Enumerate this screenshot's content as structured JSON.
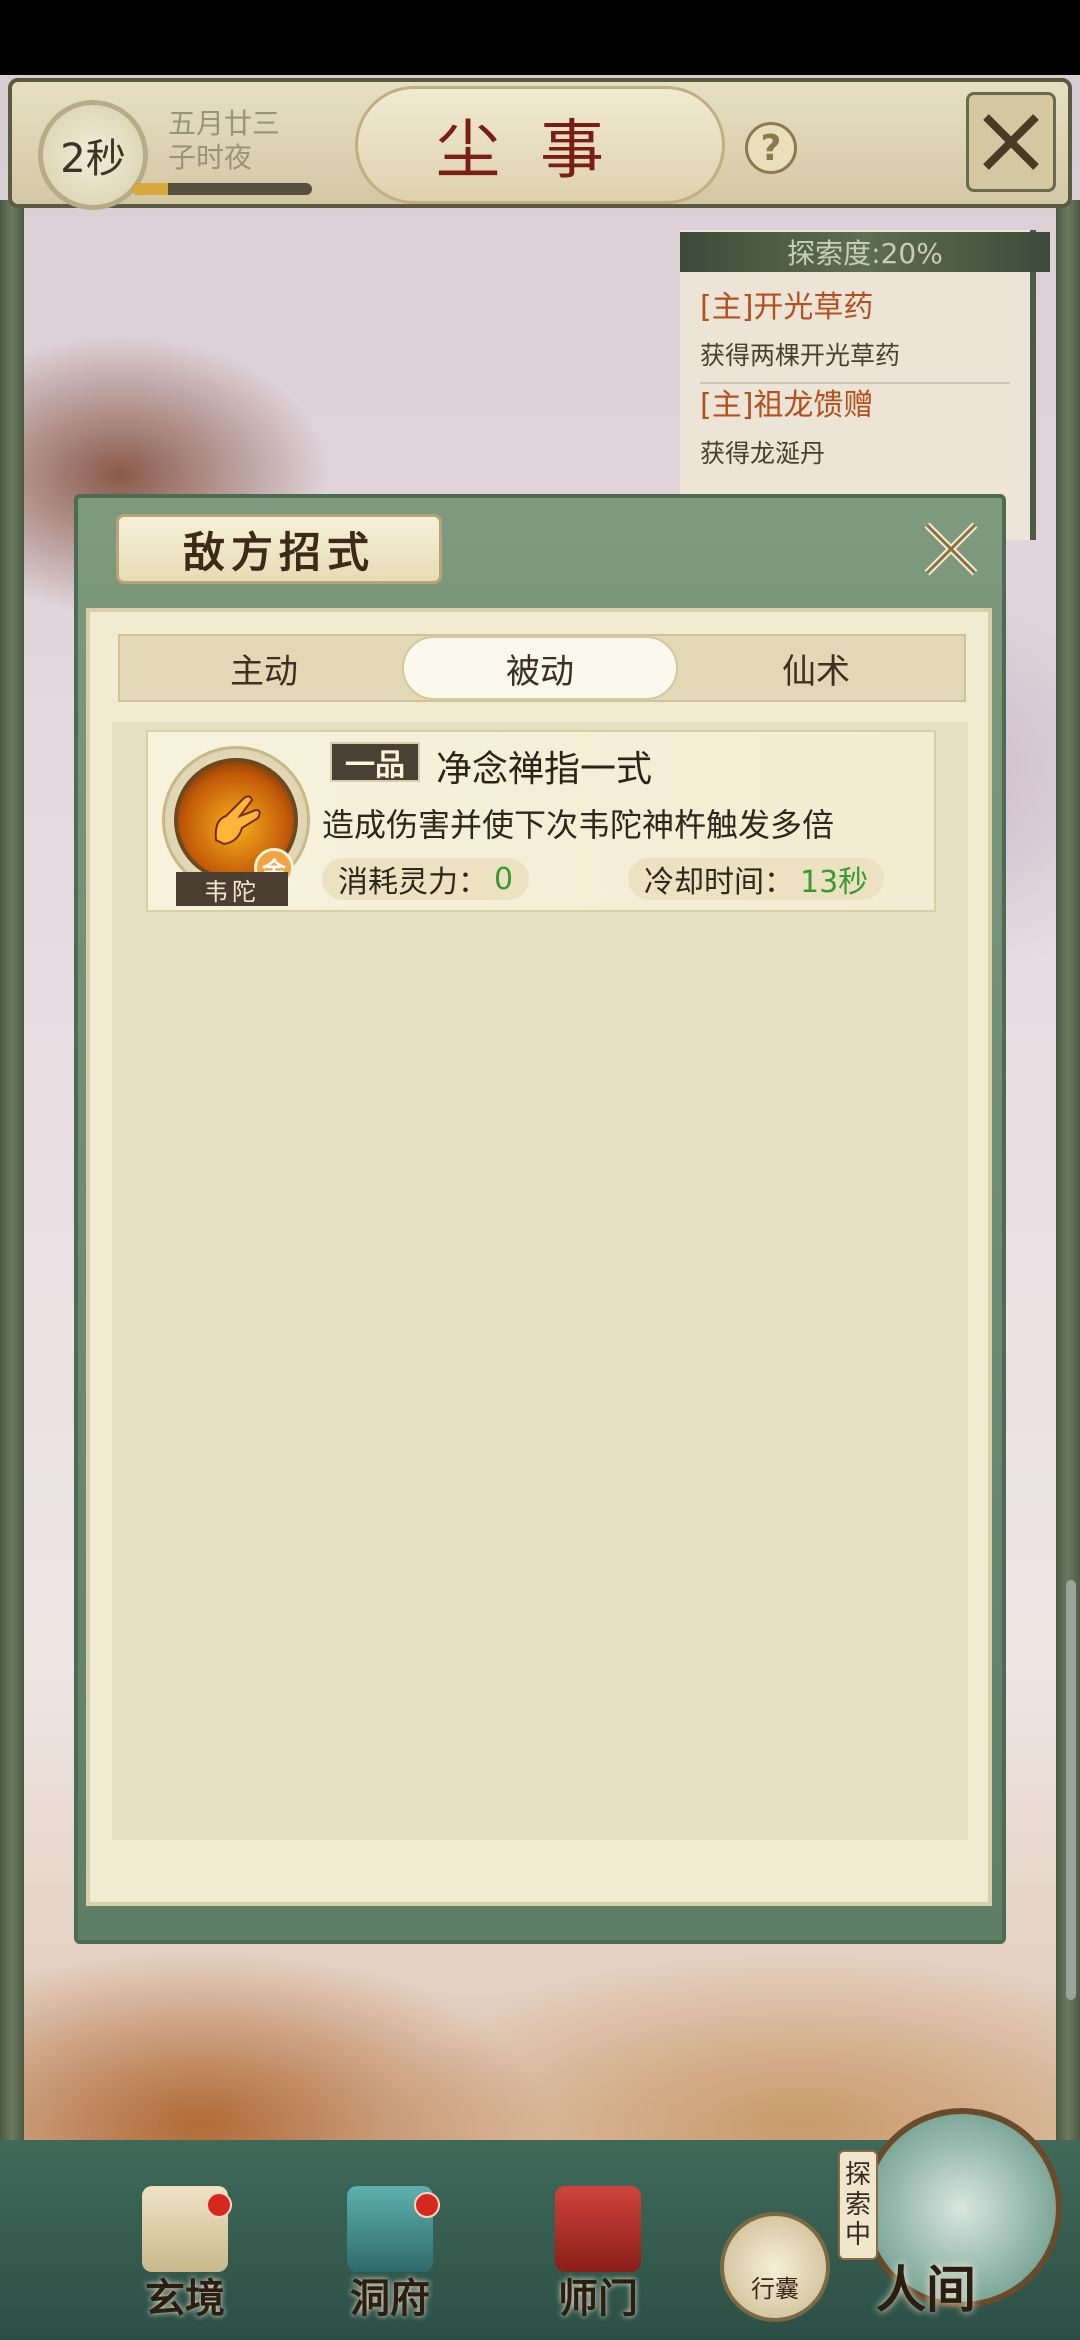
{
  "header": {
    "timer": "2秒",
    "date_line1": "五月廿三",
    "date_line2": "子时夜",
    "time_progress": 0.2,
    "title": "尘事",
    "help_label": "?"
  },
  "quest_log": {
    "progress_label": "探索度:20%",
    "items": [
      {
        "title": "[主]开光草药",
        "desc": "获得两棵开光草药"
      },
      {
        "title": "[主]祖龙馈赠",
        "desc": "获得龙涎丹"
      }
    ]
  },
  "modal": {
    "title": "敌方招式",
    "tabs": [
      {
        "label": "主动",
        "active": false
      },
      {
        "label": "被动",
        "active": true
      },
      {
        "label": "仙术",
        "active": false
      }
    ],
    "skills": [
      {
        "rank": "一品",
        "name": "净念禅指一式",
        "description": "造成伤害并使下次韦陀神杵触发多倍",
        "owner": "韦陀",
        "grade": "金",
        "cost_label": "消耗灵力：",
        "cost_value": "0",
        "cooldown_label": "冷却时间：",
        "cooldown_value": "13秒"
      }
    ]
  },
  "bottom_nav": {
    "items": [
      {
        "label": "玄境",
        "badge": true
      },
      {
        "label": "洞府",
        "badge": true
      },
      {
        "label": "师门",
        "badge": false
      }
    ],
    "bag_label": "行囊",
    "explore_tag": "探索中",
    "world_label": "人间"
  }
}
